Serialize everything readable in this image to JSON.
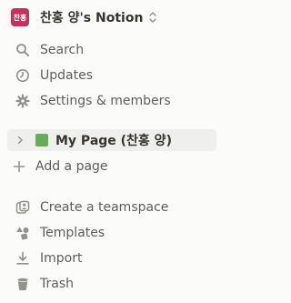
{
  "workspace": {
    "avatar_text": "찬홍",
    "name": "찬홍 양's Notion"
  },
  "nav": {
    "search": "Search",
    "updates": "Updates",
    "settings": "Settings & members"
  },
  "pages": {
    "my_page": "My Page (찬홍 양)",
    "add_page": "Add a page"
  },
  "bottom": {
    "create_teamspace": "Create a teamspace",
    "templates": "Templates",
    "import": "Import",
    "trash": "Trash"
  },
  "colors": {
    "avatar_bg": "#c5305e",
    "page_icon": "#6aab5b",
    "selected_bg": "#efefed"
  }
}
